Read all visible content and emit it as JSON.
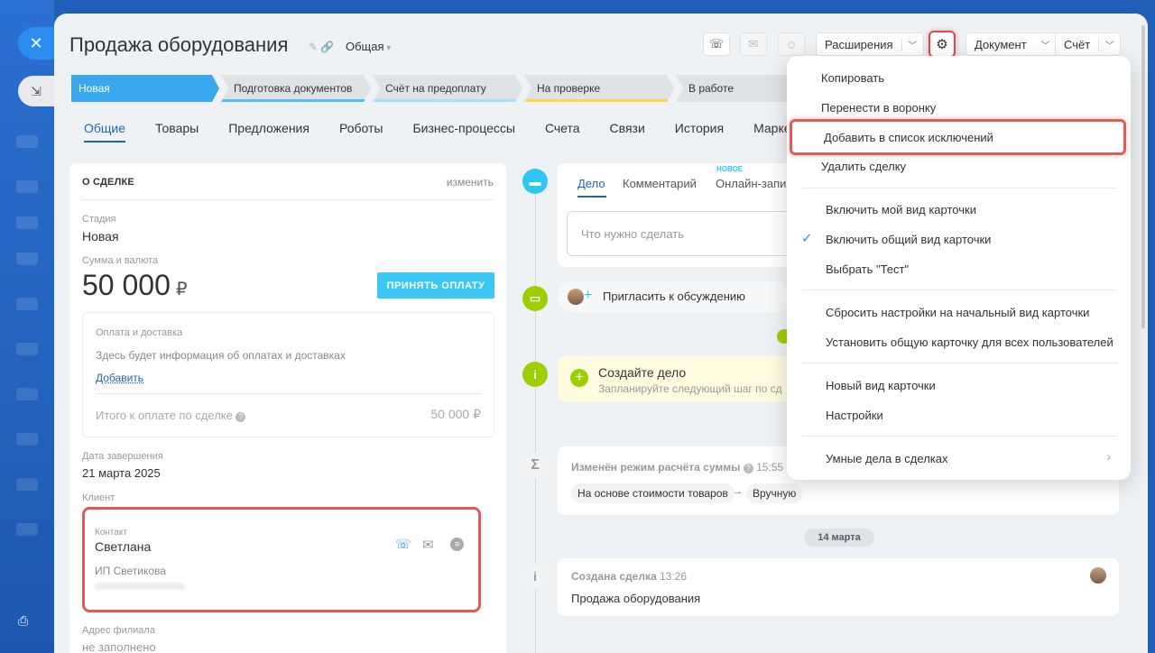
{
  "window": {
    "close_glyph": "✕"
  },
  "header": {
    "title": "Продажа оборудования",
    "funnel": "Общая",
    "extensions_label": "Расширения",
    "document_label": "Документ",
    "invoice_label": "Счёт"
  },
  "stages": [
    {
      "label": "Новая",
      "active": true
    },
    {
      "label": "Подготовка документов",
      "bar": "#4cc3f5"
    },
    {
      "label": "Счёт на предоплату",
      "bar": "#9fe3ff"
    },
    {
      "label": "На проверке",
      "bar": "#ffd83d"
    },
    {
      "label": "В работе"
    }
  ],
  "tabs": [
    "Общие",
    "Товары",
    "Предложения",
    "Роботы",
    "Бизнес-процессы",
    "Счета",
    "Связи",
    "История",
    "Марке"
  ],
  "deal": {
    "section_title": "О СДЕЛКЕ",
    "edit_label": "изменить",
    "stage_label": "Стадия",
    "stage_value": "Новая",
    "sum_label": "Сумма и валюта",
    "sum_value": "50 000",
    "currency": "₽",
    "pay_button": "ПРИНЯТЬ ОПЛАТУ",
    "payment_title": "Оплата и доставка",
    "payment_info": "Здесь будет информация об оплатах и доставках",
    "add_label": "Добавить",
    "total_label": "Итого к оплате по сделке",
    "total_value": "50 000 ₽",
    "close_date_label": "Дата завершения",
    "close_date_value": "21 марта 2025",
    "client_label": "Клиент",
    "contact_label": "Контакт",
    "contact_name": "Светлана",
    "company": "ИП Светикова",
    "branch_label": "Адрес филиала",
    "branch_value": "не заполнено"
  },
  "timeline": {
    "tabs": [
      "Дело",
      "Комментарий",
      "Онлайн-запи"
    ],
    "new_badge": "НОВОЕ",
    "todo_placeholder": "Что нужно сделать",
    "invite": "Пригласить к обсуждению",
    "create_title": "Создайте дело",
    "create_sub": "Запланируйте следующий шаг по сд",
    "mode_title": "Изменён режим расчёта суммы",
    "mode_time": "15:55",
    "mode_from": "На основе стоимости товаров",
    "mode_to": "Вручную",
    "date_pill": "14 марта",
    "created_title": "Создана сделка",
    "created_time": "13:26",
    "created_text": "Продажа оборудования"
  },
  "menu": {
    "copy": "Копировать",
    "move": "Перенести в воронку",
    "exclude": "Добавить в список исключений",
    "delete": "Удалить сделку",
    "my_view": "Включить мой вид карточки",
    "common_view": "Включить общий вид карточки",
    "choose": "Выбрать \"Тест\"",
    "reset": "Сбросить настройки на начальный вид карточки",
    "set_common": "Установить общую карточку для всех пользователей",
    "new_view": "Новый вид карточки",
    "settings": "Настройки",
    "smart": "Умные дела в сделках"
  },
  "colors": {
    "accent": "#2067b0",
    "stage_active": "#39a8ef",
    "highlight": "#e05a5a",
    "pay_button": "#3bc8f5"
  }
}
